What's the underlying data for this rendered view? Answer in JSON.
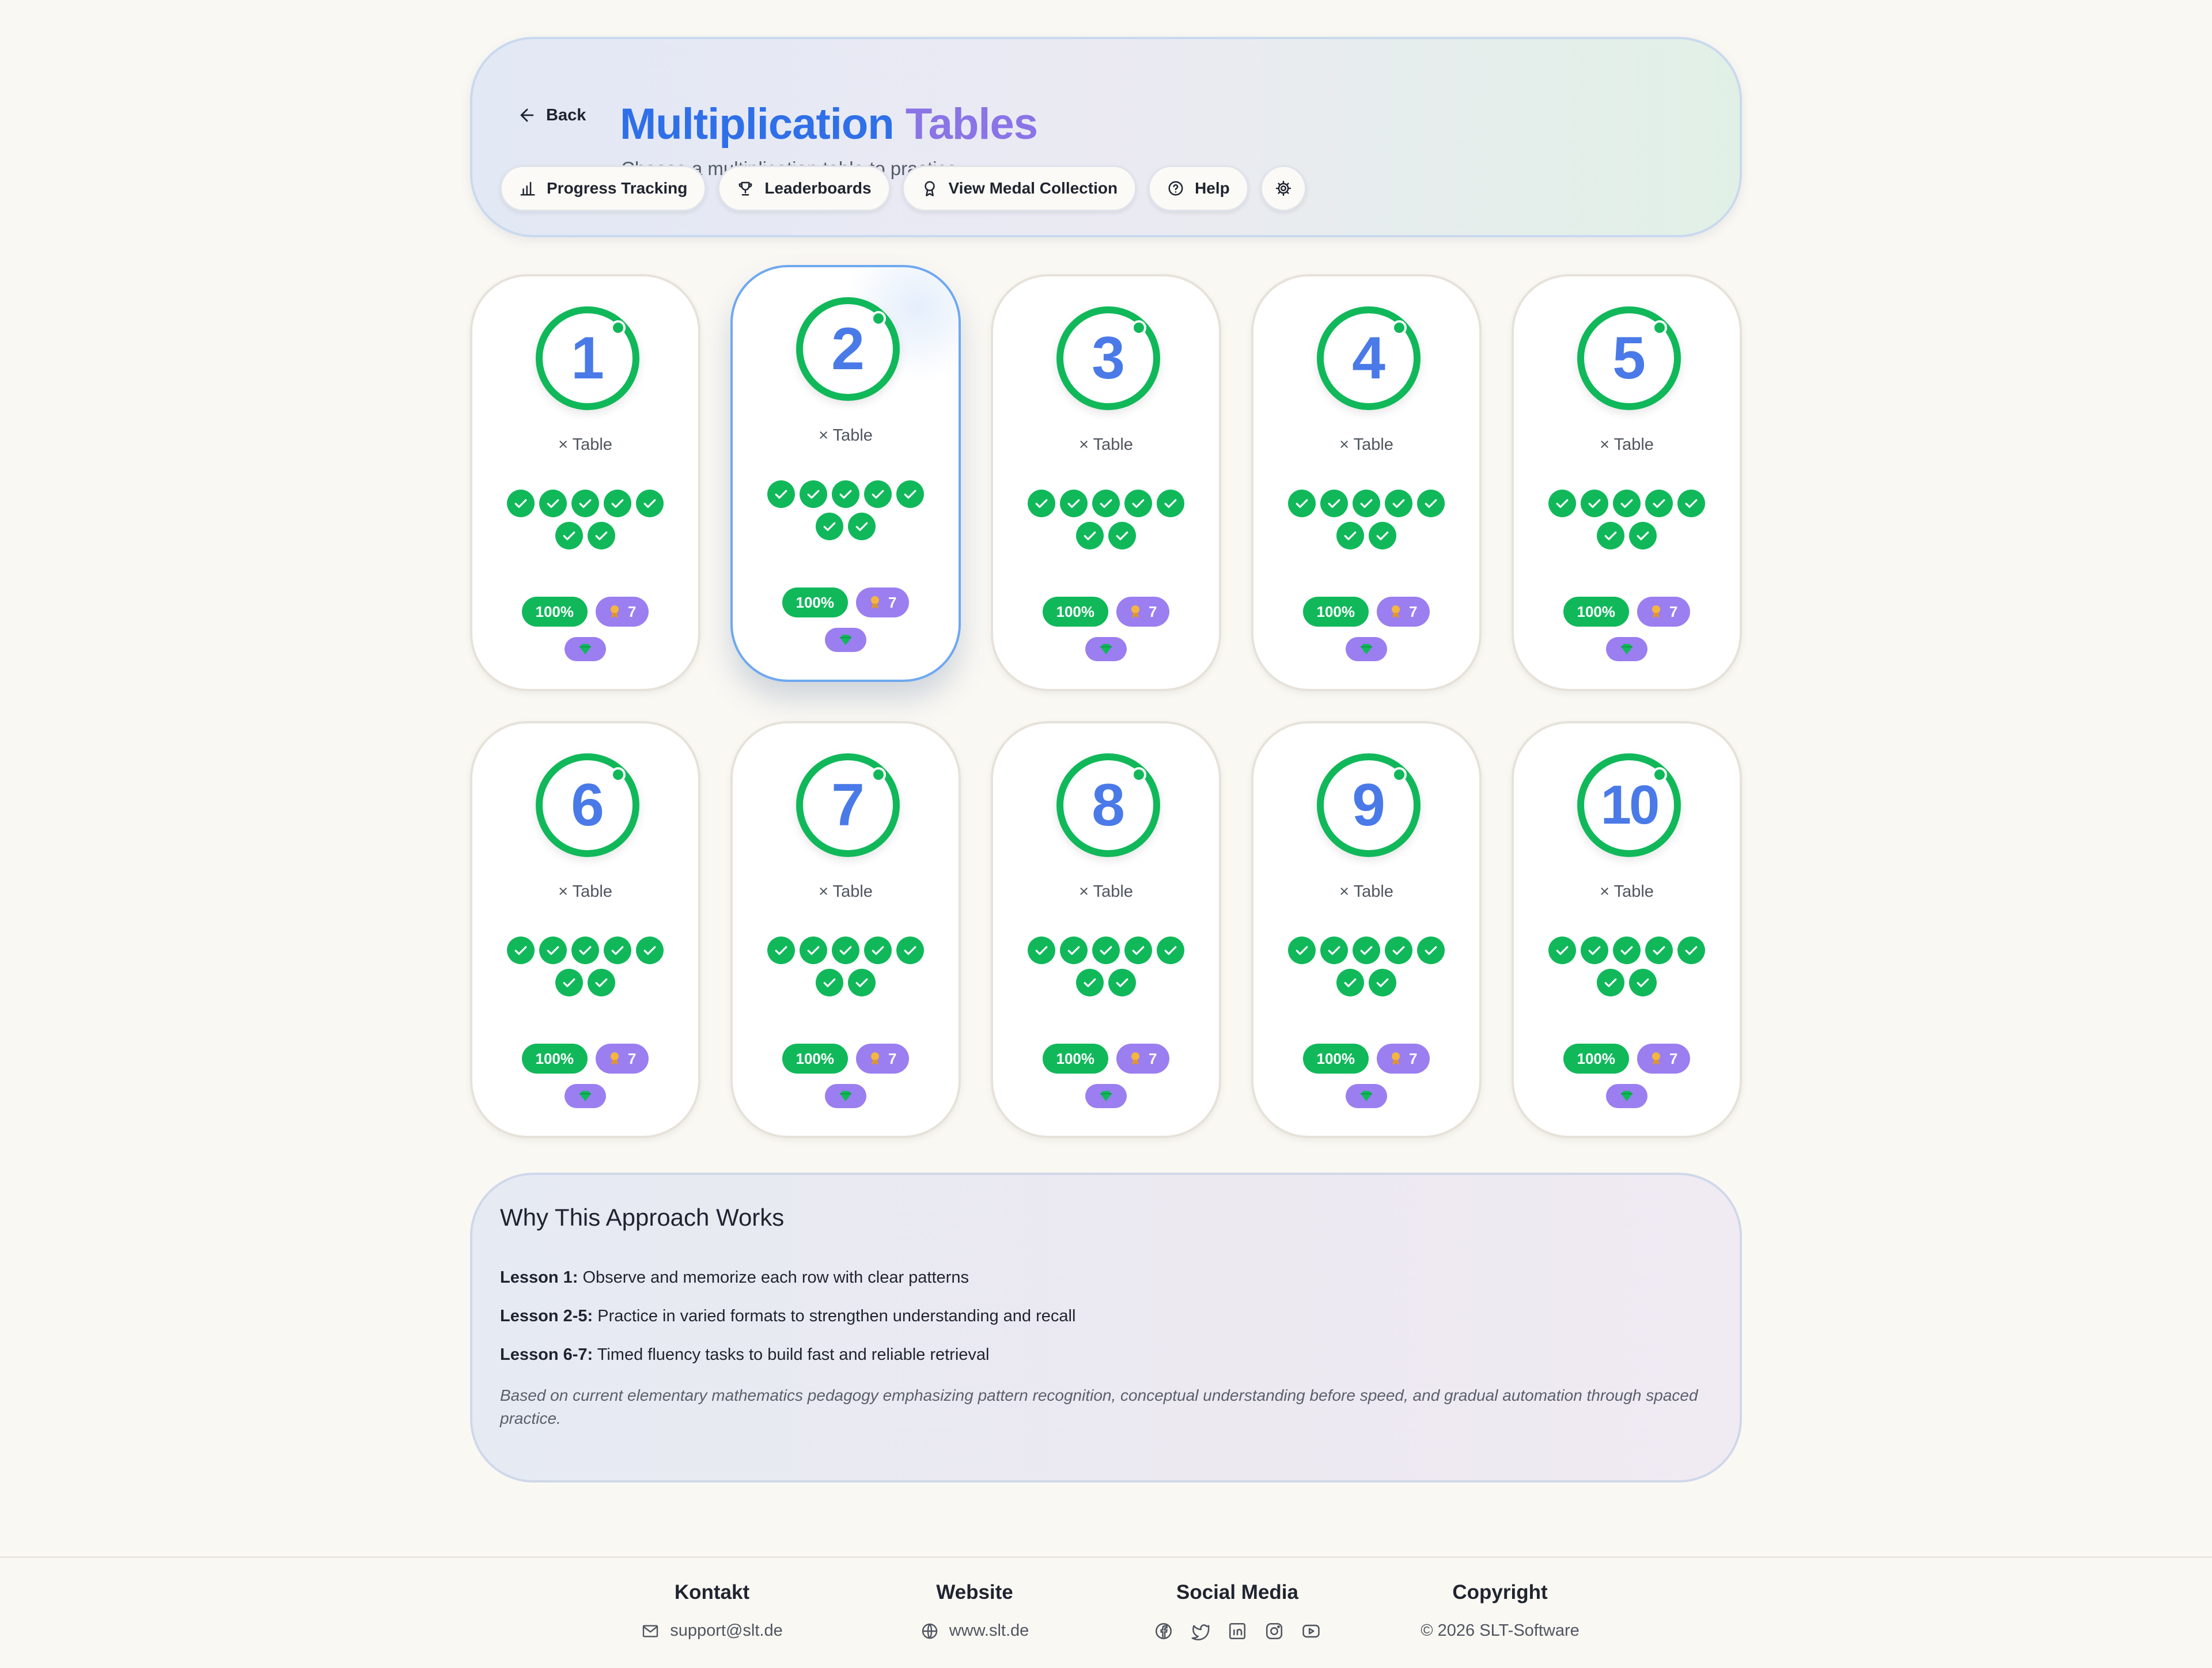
{
  "header": {
    "back_label": "Back",
    "title_part1": "Multiplication",
    "title_part2": "Tables",
    "subtitle": "Choose a multiplication table to practice",
    "toolbar": {
      "progress": "Progress Tracking",
      "leaderboards": "Leaderboards",
      "medals": "View Medal Collection",
      "help": "Help"
    }
  },
  "tables": [
    {
      "number": "1",
      "caption": "× Table",
      "percent": "100%",
      "medals": "7",
      "lessons_done": 7,
      "active": false
    },
    {
      "number": "2",
      "caption": "× Table",
      "percent": "100%",
      "medals": "7",
      "lessons_done": 7,
      "active": true
    },
    {
      "number": "3",
      "caption": "× Table",
      "percent": "100%",
      "medals": "7",
      "lessons_done": 7,
      "active": false
    },
    {
      "number": "4",
      "caption": "× Table",
      "percent": "100%",
      "medals": "7",
      "lessons_done": 7,
      "active": false
    },
    {
      "number": "5",
      "caption": "× Table",
      "percent": "100%",
      "medals": "7",
      "lessons_done": 7,
      "active": false
    },
    {
      "number": "6",
      "caption": "× Table",
      "percent": "100%",
      "medals": "7",
      "lessons_done": 7,
      "active": false
    },
    {
      "number": "7",
      "caption": "× Table",
      "percent": "100%",
      "medals": "7",
      "lessons_done": 7,
      "active": false
    },
    {
      "number": "8",
      "caption": "× Table",
      "percent": "100%",
      "medals": "7",
      "lessons_done": 7,
      "active": false
    },
    {
      "number": "9",
      "caption": "× Table",
      "percent": "100%",
      "medals": "7",
      "lessons_done": 7,
      "active": false
    },
    {
      "number": "10",
      "caption": "× Table",
      "percent": "100%",
      "medals": "7",
      "lessons_done": 7,
      "active": false
    }
  ],
  "approach": {
    "title": "Why This Approach Works",
    "lessons": [
      {
        "label": "Lesson 1:",
        "text": "Observe and memorize each row with clear patterns"
      },
      {
        "label": "Lesson 2-5:",
        "text": "Practice in varied formats to strengthen understanding and recall"
      },
      {
        "label": "Lesson 6-7:",
        "text": "Timed fluency tasks to build fast and reliable retrieval"
      }
    ],
    "note": "Based on current elementary mathematics pedagogy emphasizing pattern recognition, conceptual understanding before speed, and gradual automation through spaced practice."
  },
  "footer": {
    "contact_title": "Kontakt",
    "contact_email": "support@slt.de",
    "website_title": "Website",
    "website_url": "www.slt.de",
    "social_title": "Social Media",
    "social_icons": [
      "facebook-icon",
      "twitter-icon",
      "linkedin-icon",
      "instagram-icon",
      "youtube-icon"
    ],
    "copyright_title": "Copyright",
    "copyright_text": "© 2026 SLT-Software"
  },
  "colors": {
    "accent_blue": "#2f6fe8",
    "accent_purple": "#8a74e6",
    "success_green": "#10b85a",
    "medal_purple": "#9b7ef0"
  }
}
